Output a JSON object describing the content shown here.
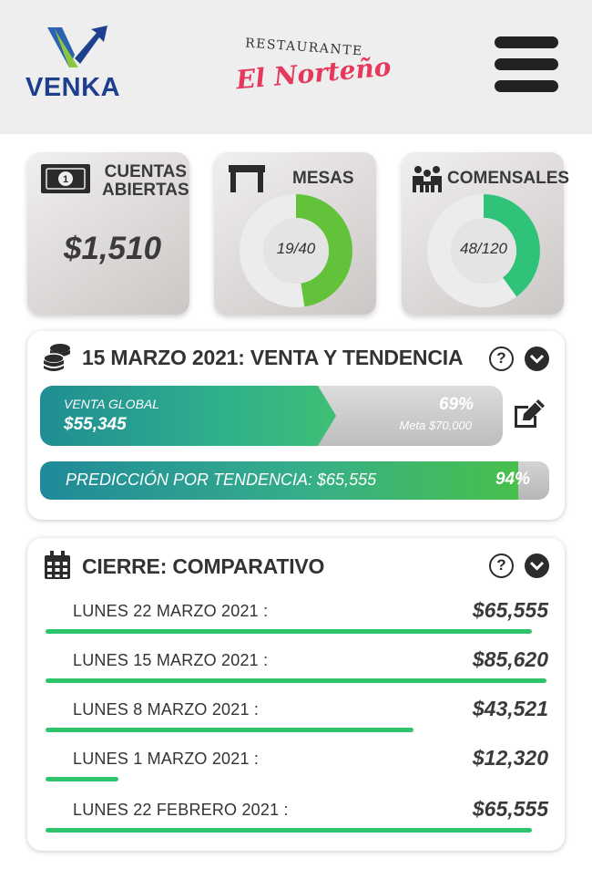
{
  "header": {
    "brand": "VENKA",
    "restaurant_top": "RESTAURANTE",
    "restaurant_name": "El Norteño"
  },
  "stats": {
    "cuentas": {
      "title_line1": "CUENTAS",
      "title_line2": "ABIERTAS",
      "value": "$1,510",
      "icon": "cash-icon"
    },
    "mesas": {
      "title": "MESAS",
      "label": "19/40",
      "fraction": 0.475,
      "icon": "table-icon"
    },
    "comensales": {
      "title": "COMENSALES",
      "label": "48/120",
      "fraction": 0.4,
      "icon": "diners-icon"
    }
  },
  "venta": {
    "title": "15 MARZO 2021: VENTA Y TENDENCIA",
    "help": "?",
    "global_label": "VENTA GLOBAL",
    "global_amount": "$55,345",
    "global_pct": "69%",
    "global_fraction": 0.69,
    "meta": "Meta $70,000",
    "prediction_label": "PREDICCIÓN POR TENDENCIA: $65,555",
    "prediction_pct": "94%",
    "prediction_fraction": 0.94
  },
  "cierre": {
    "title": "CIERRE: COMPARATIVO",
    "help": "?",
    "rows": [
      {
        "label": "LUNES 22 MARZO 2021 :",
        "value": "$65,555",
        "fraction": 0.97
      },
      {
        "label": "LUNES 15 MARZO 2021 :",
        "value": "$85,620",
        "fraction": 1.0
      },
      {
        "label": "LUNES 8 MARZO 2021 :",
        "value": "$43,521",
        "fraction": 0.735
      },
      {
        "label": "LUNES 1 MARZO 2021 :",
        "value": "$12,320",
        "fraction": 0.145
      },
      {
        "label": "LUNES 22 FEBRERO 2021 :",
        "value": "$65,555",
        "fraction": 0.97
      }
    ]
  },
  "colors": {
    "accent_green": "#2fc36c",
    "donut_green": "#62c23a",
    "donut_teal_green": "#2fc37a",
    "brand_blue": "#1e3f8e",
    "restaurant_red": "#e5385a"
  }
}
